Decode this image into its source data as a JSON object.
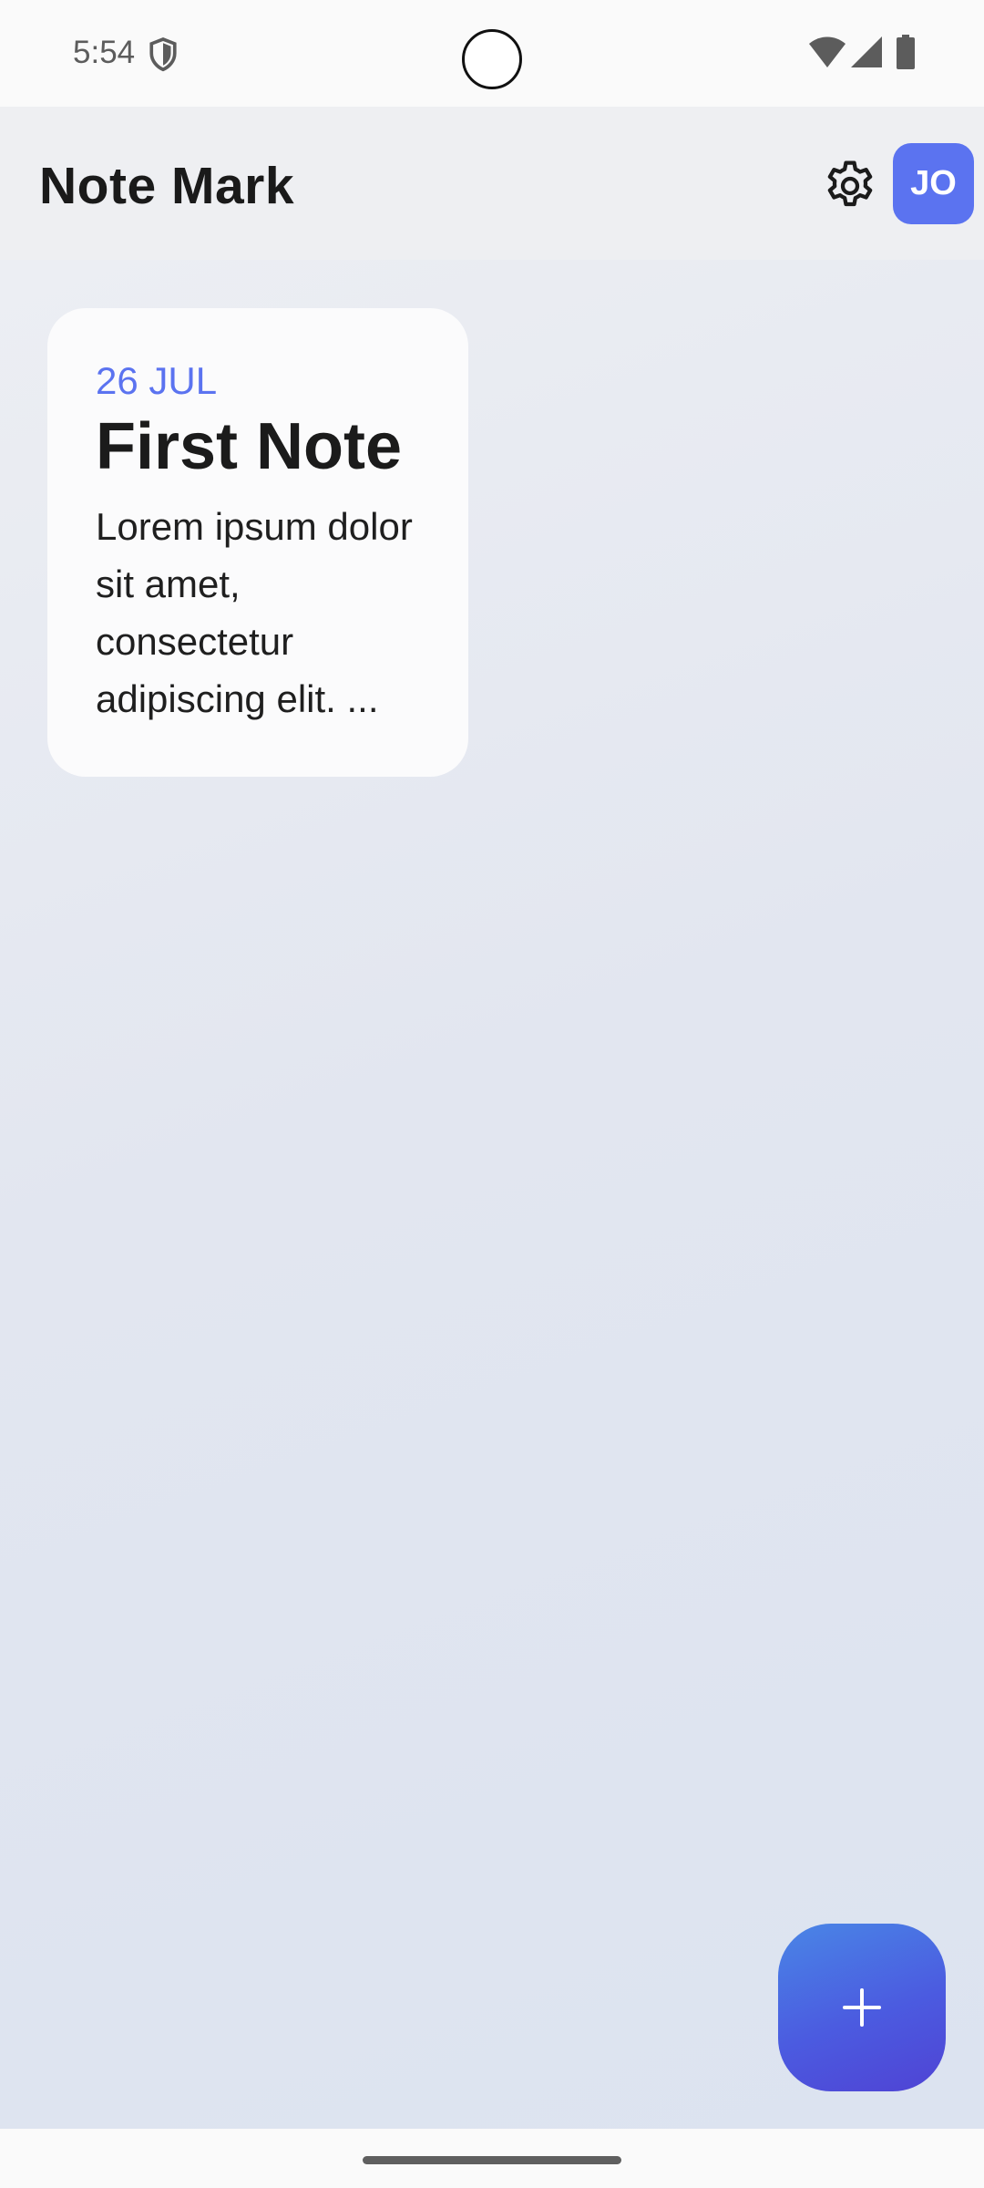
{
  "status_bar": {
    "time": "5:54",
    "icons": [
      "shield-icon",
      "wifi-icon",
      "signal-icon",
      "battery-icon"
    ]
  },
  "header": {
    "title": "Note Mark",
    "settings_icon": "gear-icon",
    "avatar_initials": "JO"
  },
  "notes": [
    {
      "date": "26 JUL",
      "title": "First Note",
      "preview": "Lorem ipsum dolor sit amet, consectetur adipiscing elit. ..."
    }
  ],
  "fab": {
    "icon": "plus-icon"
  },
  "colors": {
    "accent": "#5b73f0",
    "fab_gradient_start": "#4a86e6",
    "fab_gradient_end": "#4f43d4",
    "background": "#e2e6f0"
  }
}
